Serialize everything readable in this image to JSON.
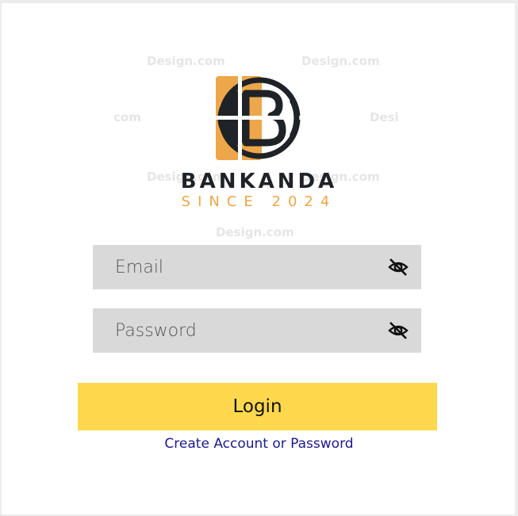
{
  "brand": {
    "name": "BANKANDA",
    "tagline": "SINCE 2024",
    "logo_icon": "bankanda-b-logo-icon",
    "colors": {
      "dark": "#1f2226",
      "orange": "#eda64a"
    }
  },
  "watermark": {
    "texts": [
      "Design.com",
      "Design.com",
      "com",
      "Desi",
      "Design.com",
      "Design.com",
      "Design.com"
    ]
  },
  "form": {
    "email": {
      "placeholder": "Email",
      "icon": "eye-off-icon"
    },
    "password": {
      "placeholder": "Password",
      "icon": "eye-off-icon"
    },
    "login_label": "Login",
    "create_link": "Create Account or Password",
    "colors": {
      "field_bg": "#d9d9d9",
      "button_bg": "#ffd84d",
      "link": "#1c1a8c"
    }
  }
}
